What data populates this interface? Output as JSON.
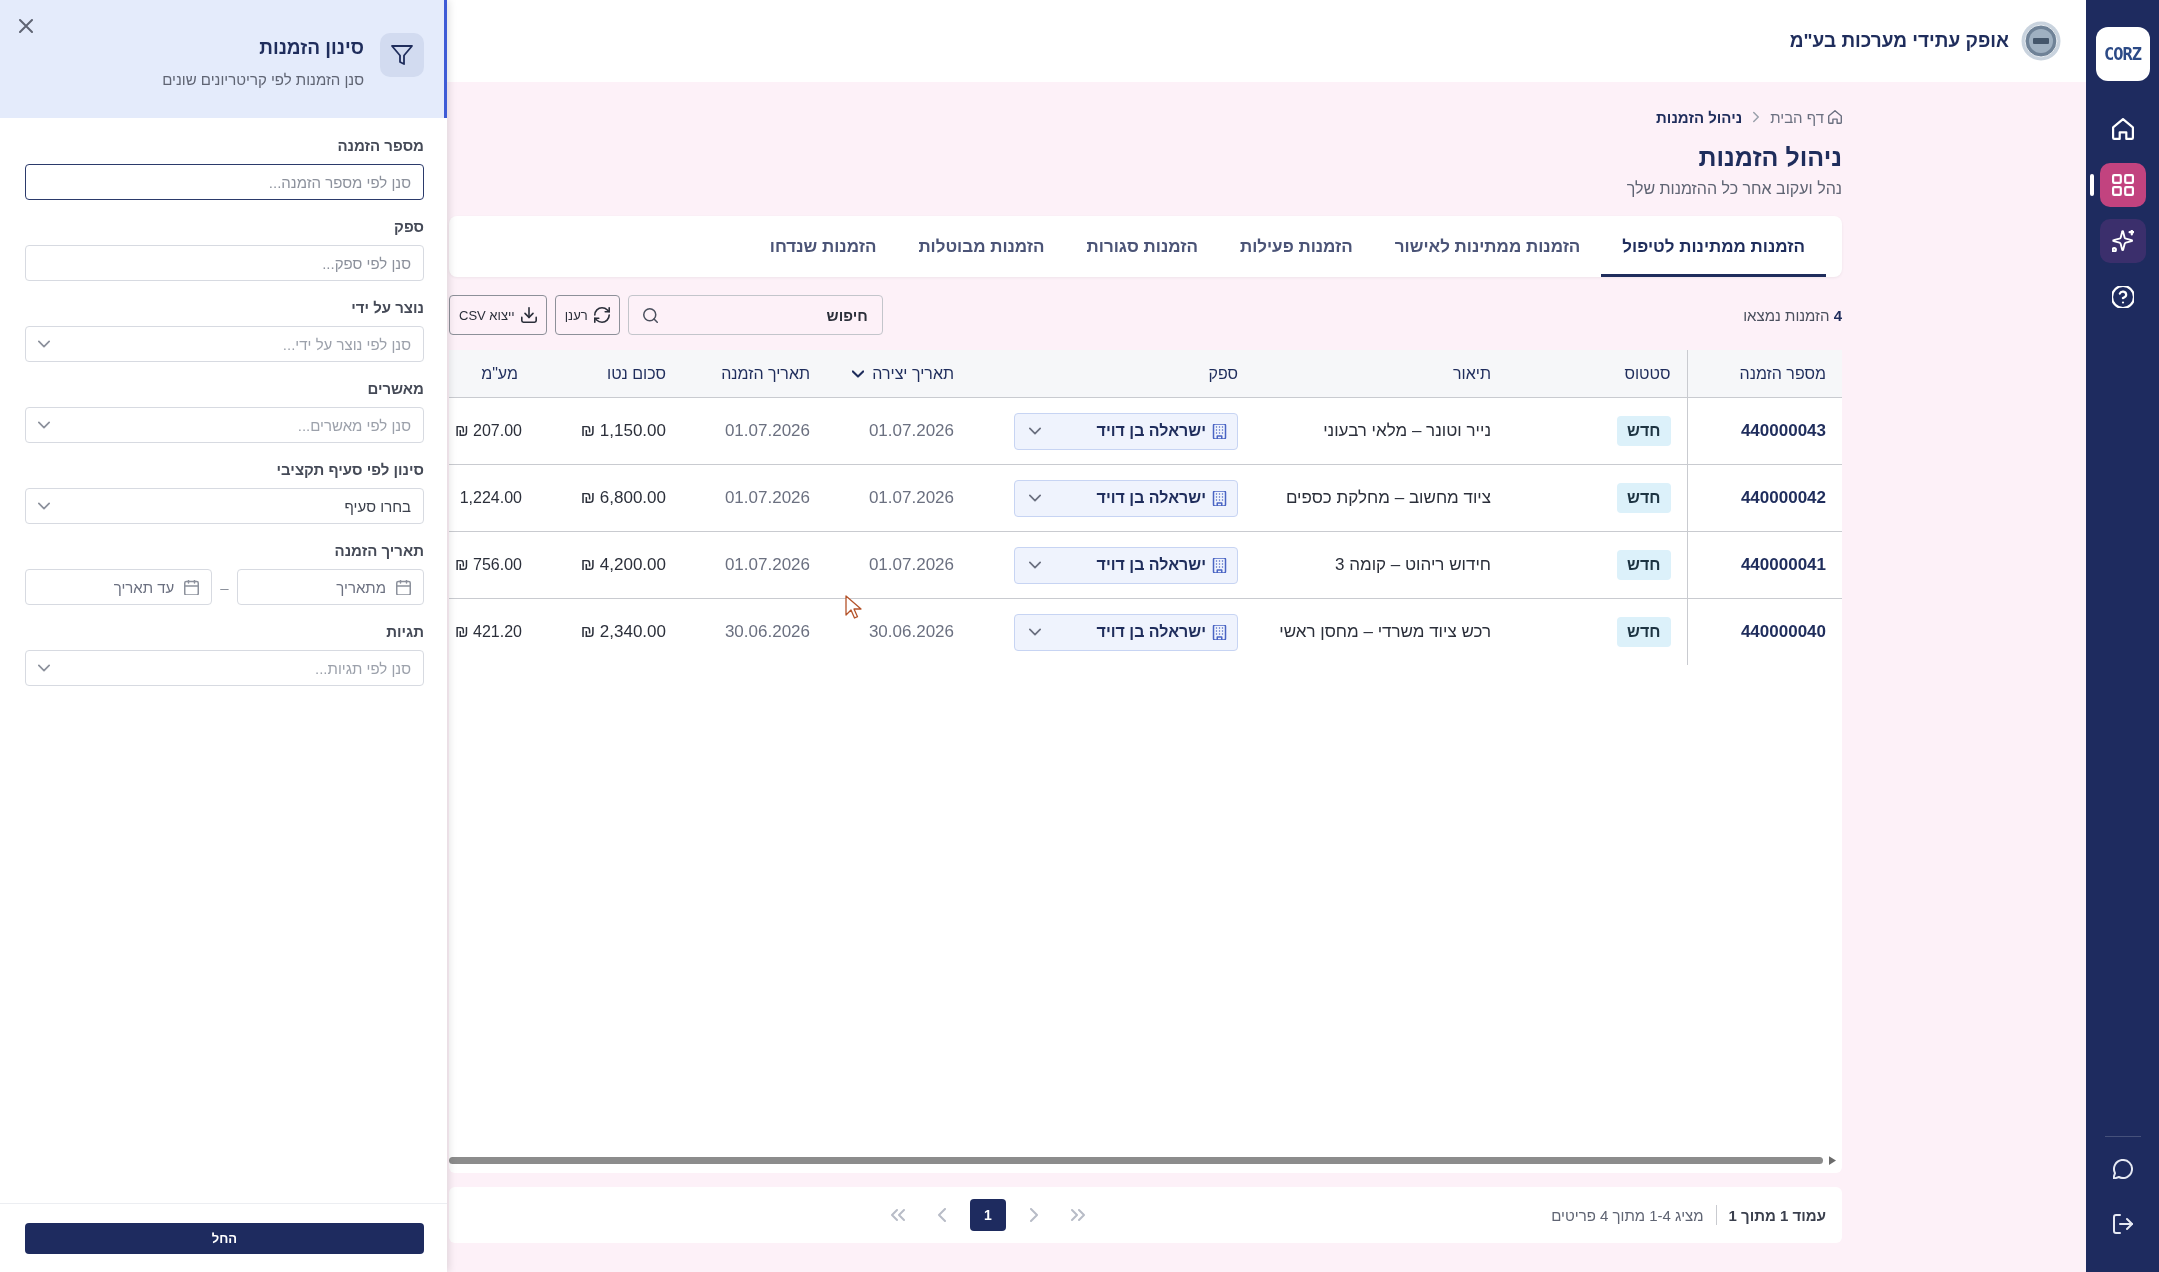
{
  "header": {
    "company_name": "אופק עתידי מערכות בע\"מ"
  },
  "sidebar": {
    "logo": "CORZ",
    "items": [
      {
        "selected": false
      },
      {
        "selected": true
      },
      {
        "selected": false
      },
      {
        "selected": false
      }
    ]
  },
  "breadcrumb": [
    {
      "label": "דף הבית",
      "current": false
    },
    {
      "label": "ניהול הזמנות",
      "current": true
    }
  ],
  "page": {
    "title": "ניהול הזמנות",
    "subtitle": "נהל ועקוב אחר כל ההזמנות שלך"
  },
  "tabs": [
    {
      "label": "הזמנות ממתינות לטיפול",
      "selected": true
    },
    {
      "label": "הזמנות ממתינות לאישור",
      "selected": false
    },
    {
      "label": "הזמנות פעילות",
      "selected": false
    },
    {
      "label": "הזמנות סגורות",
      "selected": false
    },
    {
      "label": "הזמנות מבוטלות",
      "selected": false
    },
    {
      "label": "הזמנות שנדחו",
      "selected": false
    }
  ],
  "toolbar": {
    "results_count": "**4** הזמנות נמצאו",
    "search": {
      "placeholder": "חיפוש"
    },
    "buttons": [
      {
        "kind": "refresh",
        "label": "רענן"
      },
      {
        "kind": "export",
        "label": "ייצוא CSV"
      }
    ]
  },
  "table": {
    "columns": [
      {
        "label": "מספר הזמנה",
        "sorted": false
      },
      {
        "label": "סטטוס",
        "sorted": false
      },
      {
        "label": "תיאור",
        "sorted": false
      },
      {
        "label": "ספק",
        "sorted": false
      },
      {
        "label": "תאריך יצירה",
        "sorted": true
      },
      {
        "label": "תאריך הזמנה",
        "sorted": false
      },
      {
        "label": "סכום נטו",
        "sorted": false
      },
      {
        "label": "מע\"מ",
        "sorted": false
      }
    ],
    "rows": [
      {
        "order_number": "440000043",
        "status": "חדש",
        "description": "נייר וטונר – מלאי רבעוני",
        "supplier": "ישראלה בן דויד",
        "created": "01.07.2026",
        "order_date": "01.07.2026",
        "net_amount": "1,150.00 ₪",
        "vat": "207.00 ₪"
      },
      {
        "order_number": "440000042",
        "status": "חדש",
        "description": "ציוד מחשוב – מחלקת כספים",
        "supplier": "ישראלה בן דויד",
        "created": "01.07.2026",
        "order_date": "01.07.2026",
        "net_amount": "6,800.00 ₪",
        "vat": "1,224.00"
      },
      {
        "order_number": "440000041",
        "status": "חדש",
        "description": "חידוש ריהוט – קומה 3",
        "supplier": "ישראלה בן דויד",
        "created": "01.07.2026",
        "order_date": "01.07.2026",
        "net_amount": "4,200.00 ₪",
        "vat": "756.00 ₪"
      },
      {
        "order_number": "440000040",
        "status": "חדש",
        "description": "רכש ציוד משרדי – מחסן ראשי",
        "supplier": "ישראלה בן דויד",
        "created": "30.06.2026",
        "order_date": "30.06.2026",
        "net_amount": "2,340.00 ₪",
        "vat": "421.20 ₪"
      }
    ]
  },
  "pagination": {
    "page_info": "עמוד 1 מתוך 1",
    "items_info": "מציג 1-4 מתוך 4 פריטים",
    "nav": [
      {
        "kind": "first",
        "disabled": true
      },
      {
        "kind": "prev",
        "disabled": true
      },
      {
        "kind": "next",
        "disabled": true
      },
      {
        "kind": "last",
        "disabled": true
      }
    ],
    "pages": [
      {
        "label": "1",
        "selected": true
      }
    ]
  },
  "filter_panel": {
    "title": "סינון הזמנות",
    "subtitle": "סנן הזמנות לפי קריטריונים שונים",
    "fields": [
      {
        "kind": "text",
        "label": "מספר הזמנה",
        "placeholder": "סנן לפי מספר הזמנה...",
        "focused": true
      },
      {
        "kind": "text",
        "label": "ספק",
        "placeholder": "סנן לפי ספק...",
        "focused": false
      },
      {
        "kind": "select",
        "label": "נוצר על ידי",
        "placeholder": "סנן לפי נוצר על ידי...",
        "focused": false
      },
      {
        "kind": "select",
        "label": "מאשרים",
        "placeholder": "סנן לפי מאשרים...",
        "focused": false
      },
      {
        "kind": "select",
        "label": "סינון לפי סעיף תקציבי",
        "value": "בחרו סעיף",
        "focused": false
      },
      {
        "kind": "date_range",
        "label": "תאריך הזמנה",
        "from_placeholder": "מתאריך",
        "separator": "–",
        "to_placeholder": "עד תאריך",
        "focused": false
      },
      {
        "kind": "select",
        "label": "תגיות",
        "placeholder": "סנן לפי תגיות...",
        "focused": false
      }
    ],
    "apply_button": "החל"
  }
}
